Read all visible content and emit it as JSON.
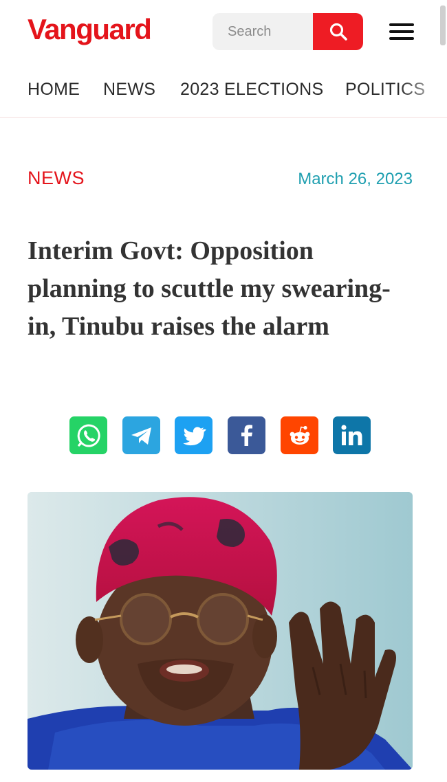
{
  "header": {
    "logo_text": "Vanguard",
    "search": {
      "placeholder": "Search"
    },
    "brand_color": "#e4141b"
  },
  "nav": {
    "items": [
      {
        "label": "HOME"
      },
      {
        "label": "NEWS"
      },
      {
        "label": "2023 ELECTIONS"
      },
      {
        "label": "POLITICS"
      }
    ]
  },
  "article": {
    "category": "NEWS",
    "date": "March 26, 2023",
    "headline": "Interim Govt: Opposition planning to scuttle my swearing-in, Tinubu raises the alarm",
    "share": [
      {
        "icon": "whatsapp-icon",
        "color": "#25d366"
      },
      {
        "icon": "telegram-icon",
        "color": "#2ca5e0"
      },
      {
        "icon": "twitter-icon",
        "color": "#1da1f2"
      },
      {
        "icon": "facebook-icon",
        "color": "#3b5998"
      },
      {
        "icon": "reddit-icon",
        "color": "#ff4500"
      },
      {
        "icon": "linkedin-icon",
        "color": "#0e76a8"
      }
    ],
    "image": {
      "subject": "man in red cap raising hand"
    }
  }
}
